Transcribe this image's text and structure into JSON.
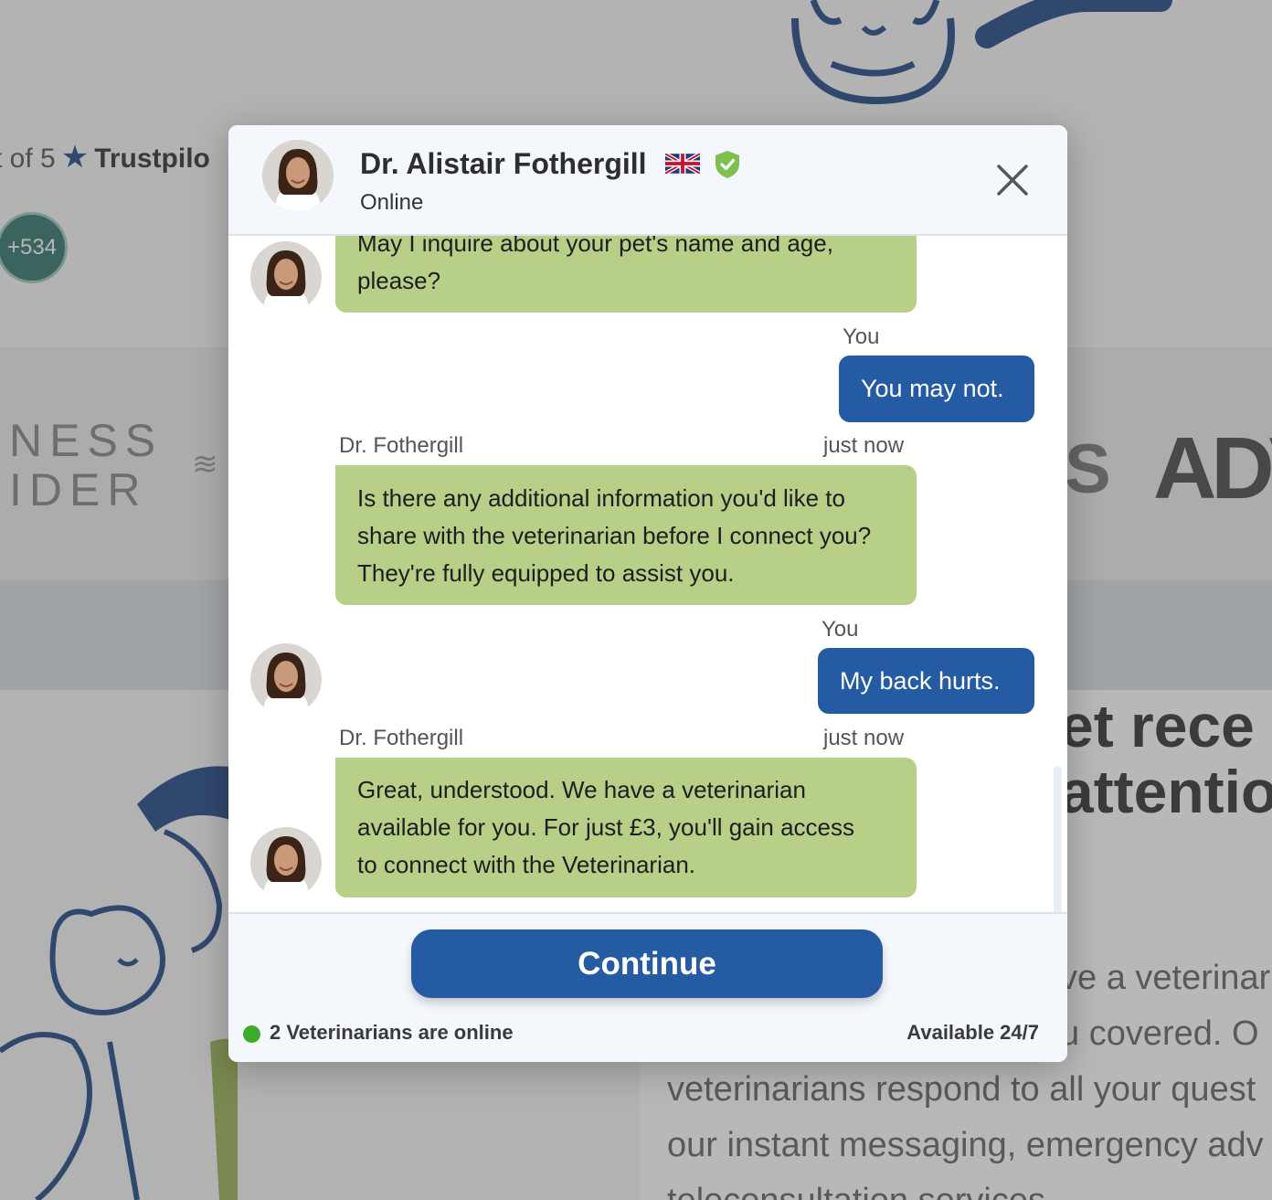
{
  "background": {
    "rating_prefix": "t of 5",
    "rating_brand": "Trustpilo",
    "avatar_count": "+534",
    "press_logo_left": "NESS\nIDER",
    "press_logo_s": "S",
    "press_logo_adv": "ADV",
    "hero_title_line1": "et rece",
    "hero_title_line2": "attentio",
    "hero_body_lines": [
      "ve a veterinar",
      "u covered. O",
      "veterinarians respond to all your quest",
      "our instant messaging, emergency adv",
      "teleconsultation services"
    ]
  },
  "modal": {
    "header": {
      "name": "Dr. Alistair Fothergill",
      "status": "Online",
      "flag_icon": "uk-flag-icon",
      "verified_icon": "verified-shield-icon",
      "close_icon": "close-icon"
    },
    "messages": [
      {
        "from": "bot",
        "text": "May I inquire about your pet's name and age, please?"
      },
      {
        "from": "user",
        "sender": "You",
        "text": "You may not."
      },
      {
        "from": "bot",
        "sender": "Dr. Fothergill",
        "time": "just now",
        "text": "Is there any additional information you'd like to share with the veterinarian before I connect you? They're fully equipped to assist you."
      },
      {
        "from": "user",
        "sender": "You",
        "text": "My back hurts."
      },
      {
        "from": "bot",
        "sender": "Dr. Fothergill",
        "time": "just now",
        "text": "Great, understood. We have a veterinarian available for you. For just £3, you'll gain access to connect with the Veterinarian."
      }
    ],
    "footer": {
      "continue_label": "Continue",
      "online_text": "2 Veterinarians are online",
      "availability": "Available 24/7"
    }
  },
  "colors": {
    "bot_bubble": "#b7cf87",
    "user_bubble": "#245ba3",
    "primary_button": "#245ba3",
    "online_dot": "#3dab2a"
  }
}
